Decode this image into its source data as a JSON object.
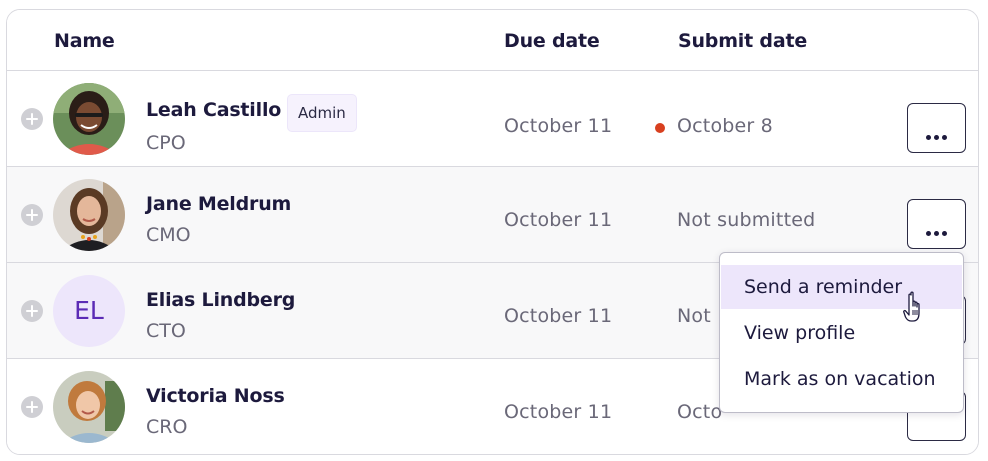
{
  "table": {
    "columns": {
      "name": "Name",
      "due_date": "Due date",
      "submit_date": "Submit date"
    },
    "rows": [
      {
        "name": "Leah Castillo",
        "role": "CPO",
        "badge": "Admin",
        "due_date": "October 11",
        "submit_date": "October 8",
        "status_color": "#d8401f",
        "avatar": "photo"
      },
      {
        "name": "Jane Meldrum",
        "role": "CMO",
        "due_date": "October 11",
        "submit_date": "Not submitted",
        "avatar": "photo"
      },
      {
        "name": "Elias Lindberg",
        "role": "CTO",
        "initials": "EL",
        "due_date": "October 11",
        "submit_date": "Not",
        "avatar": "initials"
      },
      {
        "name": "Victoria Noss",
        "role": "CRO",
        "due_date": "October 11",
        "submit_date": "Octo",
        "avatar": "photo"
      }
    ]
  },
  "context_menu": {
    "items": [
      "Send a reminder",
      "View profile",
      "Mark as on vacation"
    ],
    "highlighted_index": 0
  },
  "colors": {
    "accent_bg": "#ede6fb",
    "accent_text": "#5b2bb5",
    "late_dot": "#d8401f"
  },
  "icons": {
    "expand": "plus-circle-icon",
    "more": "ellipsis-icon",
    "cursor": "hand-pointer-icon"
  }
}
